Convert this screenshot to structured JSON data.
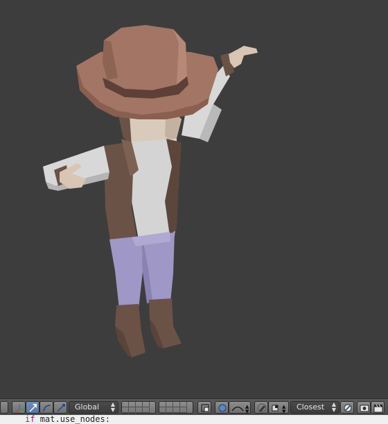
{
  "toolbar": {
    "orientation_value": "Global",
    "snap_target_value": "Closest",
    "colors": {
      "header_bg": "#525252",
      "active_button": "#5578a5",
      "viewport_bg": "#3d3d3d"
    },
    "icons": [
      "manipulator-icon",
      "translate-arrow-icon",
      "rotate-arc-icon",
      "scale-icon",
      "layer-grid-icon",
      "layer-grid-2-icon",
      "render-layer-icon",
      "pivot-circle-icon",
      "proportional-falloff-icon",
      "snap-magnet-icon",
      "snap-element-icon",
      "align-rotation-icon",
      "render-camera-icon",
      "clapperboard-icon"
    ]
  },
  "text_editor": {
    "line_keyword": "if",
    "line_code": " mat.use_nodes:"
  },
  "viewport": {
    "object": "cowboy-character-model"
  }
}
